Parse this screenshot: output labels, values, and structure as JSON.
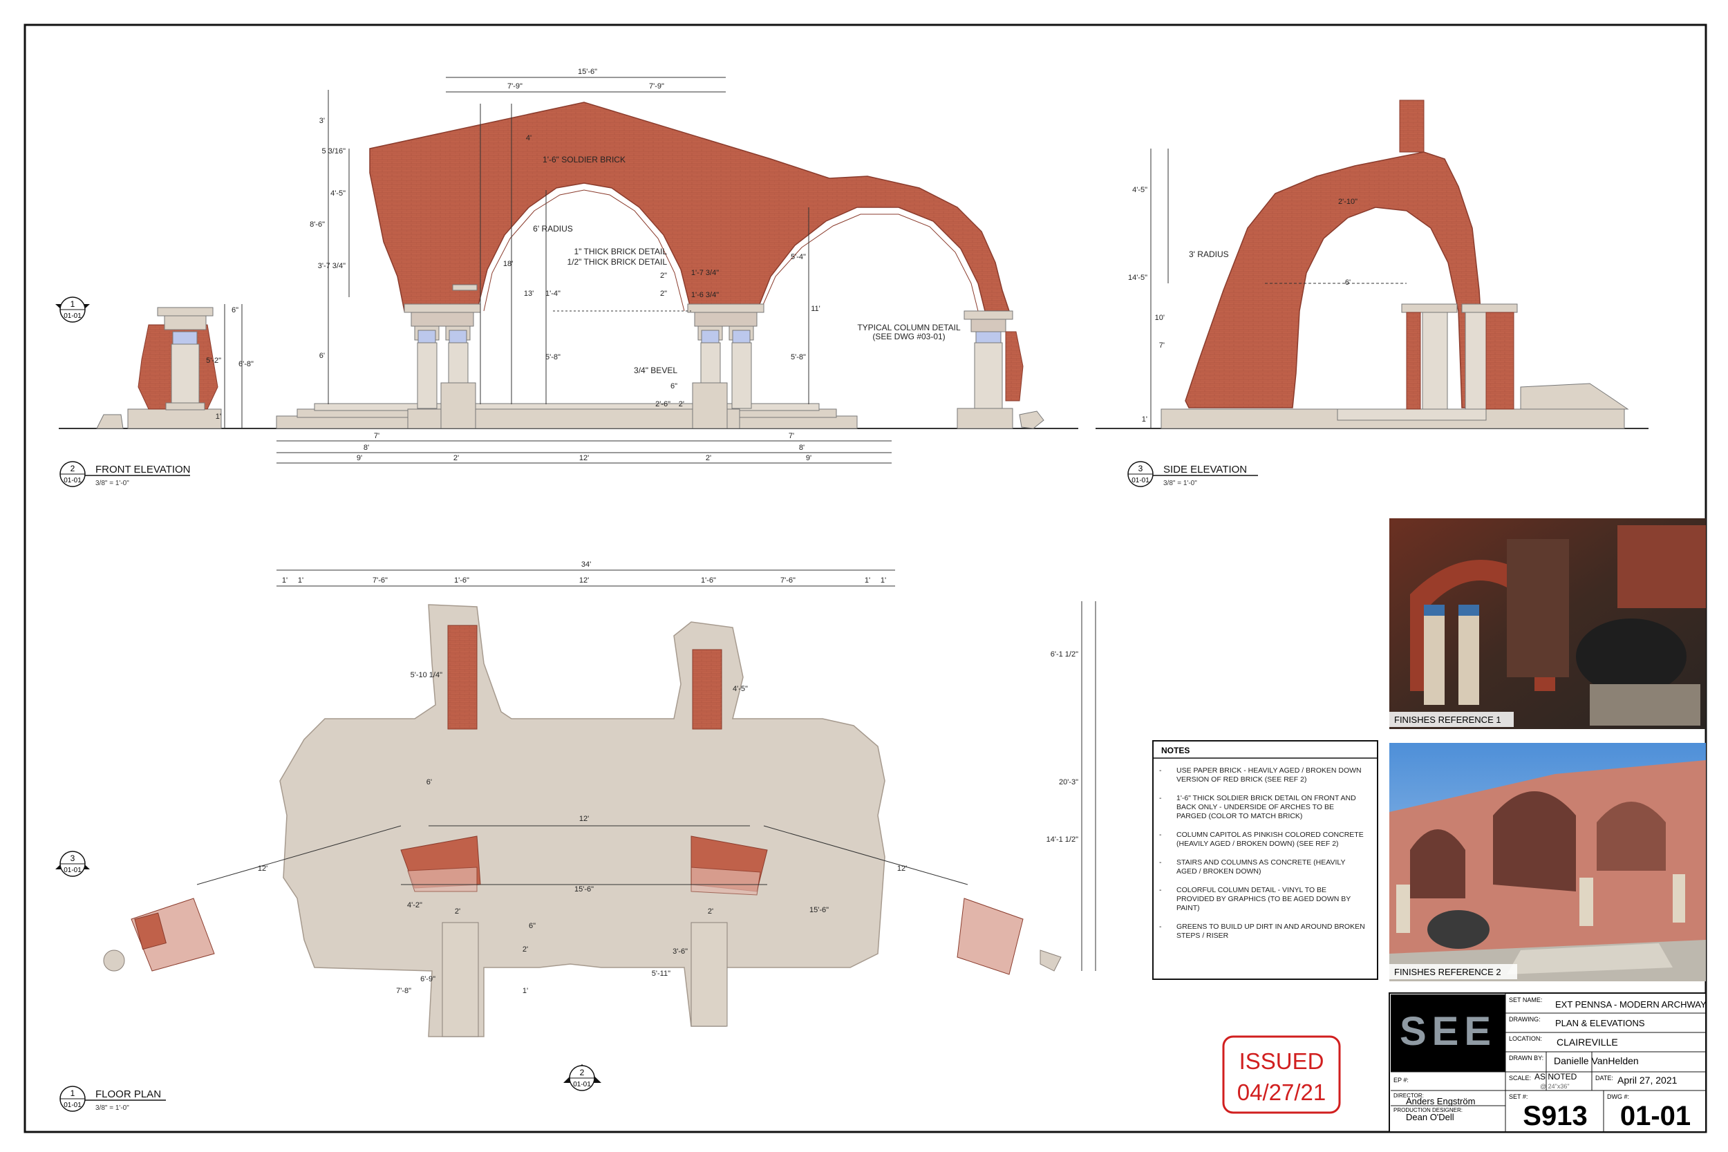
{
  "drawing": {
    "views": {
      "front": {
        "number": "2",
        "sheet": "01-01",
        "title": "FRONT ELEVATION",
        "scale": "3/8\" = 1'-0\""
      },
      "side": {
        "number": "3",
        "sheet": "01-01",
        "title": "SIDE ELEVATION",
        "scale": "3/8\" = 1'-0\""
      },
      "plan": {
        "number": "1",
        "sheet": "01-01",
        "title": "FLOOR PLAN",
        "scale": "3/8\" = 1'-0\""
      }
    },
    "section_markers": {
      "front_left": {
        "number": "1",
        "sheet": "01-01"
      },
      "plan_left": {
        "number": "3",
        "sheet": "01-01"
      },
      "plan_bottom": {
        "number": "2",
        "sheet": "01-01"
      }
    },
    "front_labels": {
      "soldier_brick": "1'-6\" SOLDIER BRICK",
      "radius": "6' RADIUS",
      "thick_brick_1": "1\" THICK BRICK DETAIL",
      "thick_brick_half": "1/2\" THICK BRICK DETAIL",
      "bevel": "3/4\" BEVEL",
      "typical_column": "TYPICAL COLUMN DETAIL",
      "see_dwg": "(SEE DWG #03-01)"
    },
    "front_dims": {
      "total_width": "15'-6\"",
      "half_left": "7'-9\"",
      "half_right": "7'-9\"",
      "top": "3'",
      "sixteenth": "5 3/16\"",
      "d_4_5": "4'-5\"",
      "d_8_6": "8'-6\"",
      "d_3_7": "3'-7 3/4\"",
      "d_4": "4'",
      "d_18": "18'",
      "d_13": "13'",
      "d_1_4": "1'-4\"",
      "d_6": "6'",
      "d_5_8a": "5'-8\"",
      "d_5_4": "5'-4\"",
      "d_11": "11'",
      "d_5_8b": "5'-8\"",
      "d_1_7": "1'-7 3/4\"",
      "d_1_6": "1'-6 3/4\"",
      "d_2a": "2\"",
      "d_2b": "2\"",
      "d_6in": "6\"",
      "d_2_6": "2'-6\"",
      "d_2in": "2'",
      "post_6": "6\"",
      "post_5_2": "5'-2\"",
      "post_6_8": "6'-8\"",
      "post_1": "1'",
      "b_7l": "7'",
      "b_8l": "8'",
      "b_9l": "9'",
      "b_2l": "2'",
      "b_12": "12'",
      "b_2r": "2'",
      "b_7r": "7'",
      "b_8r": "8'",
      "b_9r": "9'"
    },
    "side_dims": {
      "d_4_5": "4'-5\"",
      "d_2_10": "2'-10\"",
      "radius": "3' RADIUS",
      "d_14_5": "14'-5\"",
      "d_6": "6'",
      "d_10": "10'",
      "d_7": "7'",
      "d_1": "1'"
    },
    "plan_dims": {
      "top_34": "34'",
      "top_row": [
        "1'",
        "1'",
        "7'-6\"",
        "1'-6\"",
        "12'",
        "1'-6\"",
        "7'-6\"",
        "1'",
        "1'"
      ],
      "d_5_10": "5'-10 1/4\"",
      "d_4_5": "4'-5\"",
      "d_6": "6'",
      "d_12_top": "12'",
      "d_12_left": "12'",
      "d_12_right": "12'",
      "d_15_6": "15'-6\"",
      "d_15_6r": "15'-6\"",
      "d_4_2": "4'-2\"",
      "d_2a": "2'",
      "d_2b": "2'",
      "d_6in": "6\"",
      "d_2c": "2'",
      "d_3_6": "3'-6\"",
      "d_5_11": "5'-11\"",
      "d_1": "1'",
      "d_6_9": "6'-9\"",
      "d_7_8": "7'-8\"",
      "d_6_1": "6'-1 1/2\"",
      "d_20_3": "20'-3\"",
      "d_14_1": "14'-1 1/2\""
    }
  },
  "notes": {
    "heading": "NOTES",
    "items": [
      "USE PAPER BRICK - HEAVILY AGED / BROKEN DOWN VERSION OF RED BRICK (SEE REF 2)",
      "1'-6\" THICK SOLDIER BRICK DETAIL ON FRONT AND BACK ONLY - UNDERSIDE OF ARCHES TO BE PARGED (COLOR TO MATCH BRICK)",
      "COLUMN CAPITOL AS PINKISH COLORED CONCRETE (HEAVILY AGED / BROKEN DOWN) (SEE REF 2)",
      "STAIRS AND COLUMNS AS CONCRETE (HEAVILY AGED / BROKEN DOWN)",
      "COLORFUL COLUMN DETAIL - VINYL TO BE PROVIDED BY GRAPHICS (TO BE AGED DOWN BY PAINT)",
      "GREENS TO BUILD UP DIRT IN AND AROUND BROKEN STEPS / RISER"
    ],
    "lines": [
      [
        "USE PAPER BRICK - HEAVILY AGED / BROKEN DOWN",
        "VERSION OF RED BRICK (SEE REF 2)"
      ],
      [
        "1'-6\" THICK SOLDIER BRICK DETAIL ON FRONT AND",
        "BACK ONLY - UNDERSIDE OF ARCHES TO BE",
        "PARGED (COLOR TO MATCH BRICK)"
      ],
      [
        "COLUMN CAPITOL AS PINKISH COLORED CONCRETE",
        "(HEAVILY AGED / BROKEN DOWN) (SEE REF 2)"
      ],
      [
        "STAIRS AND COLUMNS AS CONCRETE (HEAVILY",
        "AGED / BROKEN DOWN)"
      ],
      [
        "COLORFUL COLUMN DETAIL - VINYL TO BE",
        "PROVIDED BY GRAPHICS (TO BE AGED DOWN BY",
        "PAINT)"
      ],
      [
        "GREENS TO BUILD UP DIRT IN AND AROUND BROKEN",
        "STEPS / RISER"
      ]
    ]
  },
  "references": {
    "ref1": "FINISHES REFERENCE 1",
    "ref2": "FINISHES REFERENCE 2"
  },
  "stamp": {
    "line1": "ISSUED",
    "line2": "04/27/21"
  },
  "title_block": {
    "logo": "SEE",
    "set_name_label": "SET NAME:",
    "set_name": "EXT PENNSA - MODERN ARCHWAY",
    "drawing_label": "DRAWING:",
    "drawing": "PLAN & ELEVATIONS",
    "location_label": "LOCATION:",
    "location": "CLAIREVILLE",
    "drawn_by_label": "DRAWN BY:",
    "drawn_by": "Danielle VanHelden",
    "ep_label": "EP #:",
    "scale_label": "SCALE:",
    "scale": "AS NOTED",
    "scale_sub": "@ 24\"x36\"",
    "date_label": "DATE:",
    "date": "April 27, 2021",
    "director_label": "DIRECTOR:",
    "director": "Anders Engström",
    "pd_label": "PRODUCTION DESIGNER:",
    "pd": "Dean O'Dell",
    "set_no_label": "SET #:",
    "set_no": "S913",
    "dwg_label": "DWG #:",
    "dwg": "01-01"
  },
  "colors": {
    "brick": "#c0614a",
    "brick_dark": "#9a4535",
    "concrete": "#dcd3c7",
    "plan_fill": "#d9d0c5",
    "stamp": "#d11f1f",
    "column_blue": "#bcc8ec"
  }
}
